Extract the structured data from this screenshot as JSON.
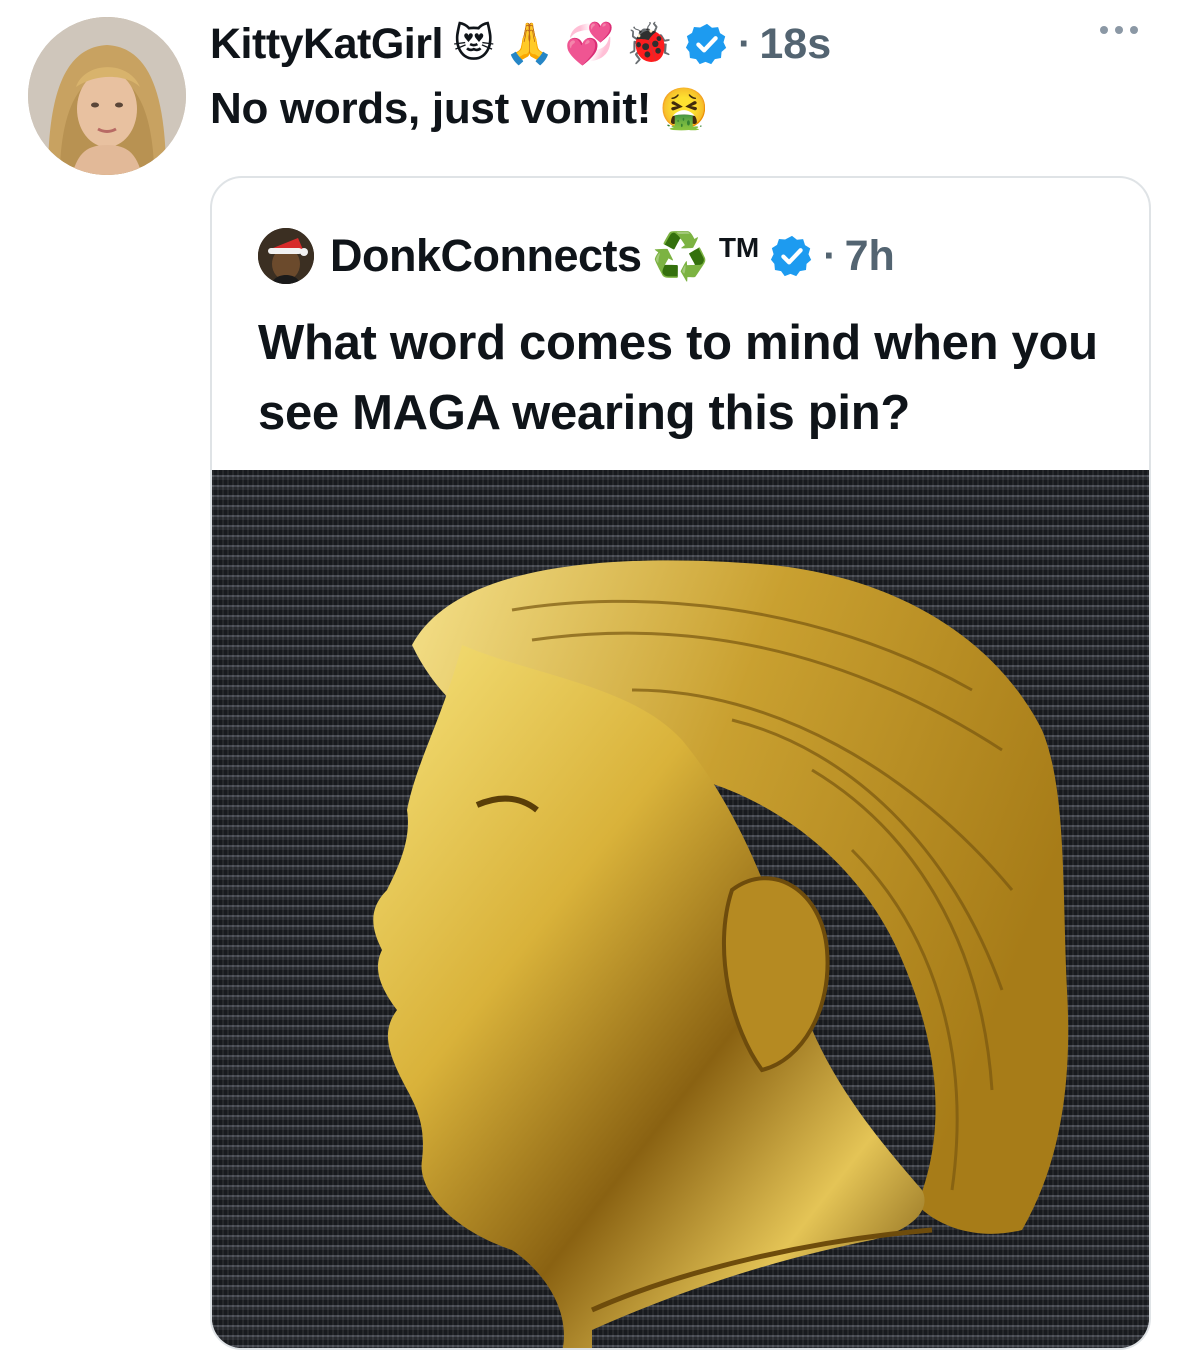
{
  "tweet": {
    "display_name": "KittyKatGirl",
    "name_emojis": [
      "😻",
      "🙏",
      "💞",
      "🐞"
    ],
    "verified_color": "#1d9bf0",
    "separator": "·",
    "timestamp": "18s",
    "text": "No words, just vomit!",
    "text_emoji": "🤮"
  },
  "quoted_tweet": {
    "display_name": "DonkConnects",
    "name_suffix_emoji": "♻️",
    "trademark": "TM",
    "separator": "·",
    "timestamp": "7h",
    "text": "What word comes to mind when you see MAGA wearing this pin?",
    "media_description_icon": "gold-profile-pin"
  },
  "colors": {
    "text_primary": "#0f1419",
    "text_secondary": "#536471",
    "border": "#dfe3e6",
    "verified_blue": "#1d9bf0",
    "gold": "#d9b23a"
  },
  "icons": [
    "more-dots-icon",
    "verified-badge-icon",
    "recycle-icon"
  ]
}
